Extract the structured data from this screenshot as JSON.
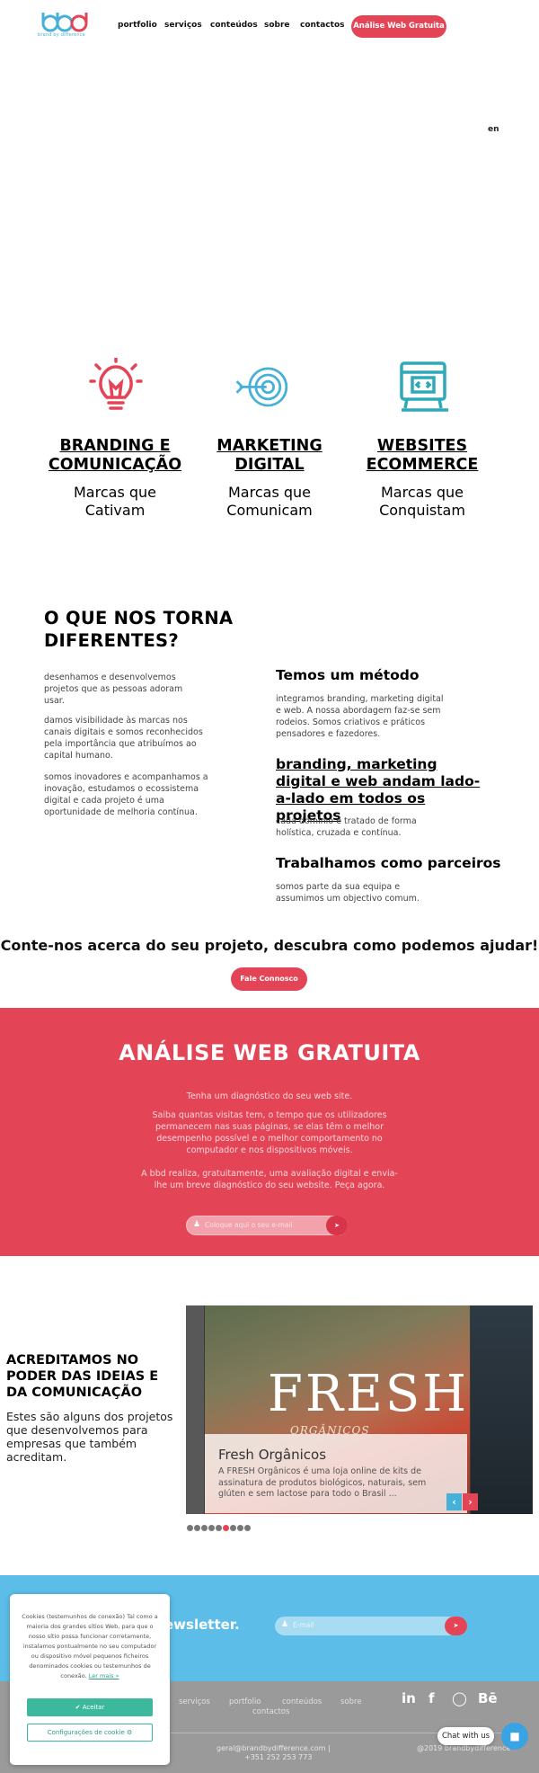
{
  "brand": {
    "logo_text": "bbd",
    "tagline": "brand by difference",
    "colors": {
      "primary": "#e44556",
      "accent": "#46b0d8",
      "newsletter_bg": "#5bbde8"
    }
  },
  "nav": {
    "items": [
      "portfolio",
      "serviços",
      "conteúdos",
      "sobre",
      "contactos"
    ],
    "cta": "Análise Web Gratuita"
  },
  "language": "en",
  "services": [
    {
      "icon": "lightbulb-icon",
      "title": "BRANDING E COMUNICAÇÃO",
      "subtitle": "Marcas que Cativam"
    },
    {
      "icon": "target-icon",
      "title": "MARKETING DIGITAL",
      "subtitle": "Marcas que Comunicam"
    },
    {
      "icon": "web-code-icon",
      "title": "WEBSITES ECOMMERCE",
      "subtitle": "Marcas que Conquistam"
    }
  ],
  "diferentes": {
    "title": "O QUE NOS TORNA DIFERENTES?",
    "paragraphs": [
      "desenhamos e desenvolvemos projetos que as pessoas adoram usar.",
      "damos visibilidade às marcas nos canais digitais e somos reconhecidos pela importância que atribuímos ao capital humano.",
      "somos inovadores e acompanhamos a inovação, estudamos o ecossistema digital e cada projeto é uma oportunidade de melhoria contínua."
    ],
    "method_title": "Temos um método",
    "method_text": "integramos branding, marketing digital e web. A nossa abordagem faz-se sem rodeios. Somos criativos e práticos pensadores e fazedores.",
    "side_title": "branding, marketing digital e web andam lado-a-lado em todos os projetos",
    "side_text": "cada domínio é tratado de forma holística, cruzada e contínua.",
    "partners_title": "Trabalhamos como parceiros",
    "partners_text": "somos parte da sua equipa e assumimos um objectivo comum."
  },
  "contact_cta": {
    "heading": "Conte-nos acerca do seu projeto, descubra como podemos ajudar!",
    "button": "Fale Connosco"
  },
  "analise": {
    "title": "ANÁLISE WEB GRATUITA",
    "p1": "Tenha um diagnóstico do seu web site.",
    "p2": "Saiba quantas visitas tem, o tempo que os utilizadores permanecem nas suas páginas, se elas têm o melhor desempenho possível e o melhor comportamento no computador e nos dispositivos móveis.",
    "p3": "A bbd realiza, gratuitamente, uma avaliação digital e envia-lhe um breve diagnóstico do seu website. Peça agora.",
    "input_placeholder": "Coloque aqui o seu e-mail"
  },
  "projects": {
    "title": "ACREDITAMOS NO PODER DAS IDEIAS E DA COMUNICAÇÃO",
    "text": "Estes são alguns dos projetos que desenvolvemos para empresas que também acreditam.",
    "slide": {
      "image_word": "FRESH",
      "image_sub": "ORGÂNICOS",
      "title": "Fresh Orgânicos",
      "text": "A FRESH Orgânicos é uma loja online de kits de assinatura de produtos biológicos, naturais, sem glúten e sem lactose para todo o Brasil ..."
    },
    "dot_count": 9,
    "active_dot": 5
  },
  "newsletter": {
    "title": "Subscreva a nossa newsletter.",
    "visible_title": "ewsletter.",
    "input_placeholder": "E-mail"
  },
  "footer": {
    "links": [
      "serviços",
      "portfolio",
      "conteúdos",
      "sobre"
    ],
    "link_contactos": "contactos",
    "email": "geral@brandbydifference.com |",
    "phone": "+351 252 253 773",
    "copyright": "@2019 brandbydifference",
    "social": [
      "linkedin-icon",
      "facebook-icon",
      "instagram-icon",
      "behance-icon"
    ]
  },
  "cookie": {
    "text": "Cookies (testemunhos de conexão) Tal como a maioria dos grandes sítios Web, para que o nosso sítio possa funcionar corretamente, instalamos pontualmente no seu computador ou dispositivo móvel pequenos ficheiros denominados cookies ou testemunhos de conexão.",
    "more": "Ler mais »",
    "accept": "Aceitar",
    "config": "Configurações de cookie"
  },
  "chat": {
    "label": "Chat with us"
  }
}
